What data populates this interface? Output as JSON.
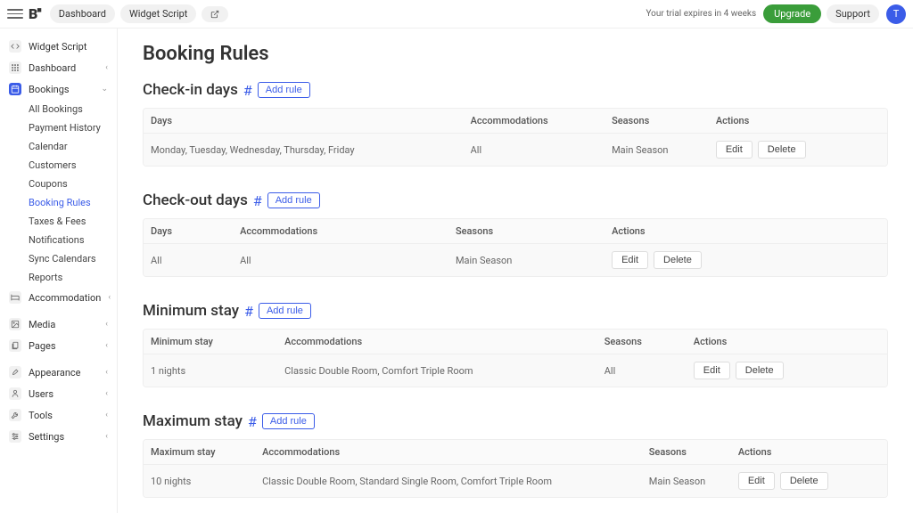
{
  "topbar": {
    "dashboard_label": "Dashboard",
    "widget_script_label": "Widget Script",
    "trial_text": "Your trial expires in 4 weeks",
    "upgrade_label": "Upgrade",
    "support_label": "Support",
    "avatar_initial": "T"
  },
  "sidebar": {
    "items": [
      {
        "label": "Widget Script",
        "icon": "code"
      },
      {
        "label": "Dashboard",
        "icon": "grid",
        "chev": "‹"
      },
      {
        "label": "Bookings",
        "icon": "calendar",
        "active": true,
        "chev": "⌄",
        "sub": [
          {
            "label": "All Bookings"
          },
          {
            "label": "Payment History"
          },
          {
            "label": "Calendar"
          },
          {
            "label": "Customers"
          },
          {
            "label": "Coupons"
          },
          {
            "label": "Booking Rules",
            "selected": true
          },
          {
            "label": "Taxes & Fees"
          },
          {
            "label": "Notifications"
          },
          {
            "label": "Sync Calendars"
          },
          {
            "label": "Reports"
          }
        ]
      },
      {
        "label": "Accommodation",
        "icon": "bed",
        "chev": "‹"
      },
      {
        "label": "Media",
        "icon": "image",
        "chev": "‹"
      },
      {
        "label": "Pages",
        "icon": "pages",
        "chev": "‹"
      },
      {
        "label": "Appearance",
        "icon": "brush",
        "chev": "‹"
      },
      {
        "label": "Users",
        "icon": "user",
        "chev": "‹"
      },
      {
        "label": "Tools",
        "icon": "wrench",
        "chev": "‹"
      },
      {
        "label": "Settings",
        "icon": "sliders",
        "chev": "‹"
      }
    ]
  },
  "page": {
    "title": "Booking Rules",
    "anchor": "#",
    "add_rule_label": "Add rule",
    "edit_label": "Edit",
    "delete_label": "Delete",
    "sections": {
      "checkin": {
        "title": "Check-in days",
        "columns": [
          "Days",
          "Accommodations",
          "Seasons",
          "Actions"
        ],
        "row": {
          "days": "Monday, Tuesday, Wednesday, Thursday, Friday",
          "accom": "All",
          "season": "Main Season"
        }
      },
      "checkout": {
        "title": "Check-out days",
        "columns": [
          "Days",
          "Accommodations",
          "Seasons",
          "Actions"
        ],
        "row": {
          "days": "All",
          "accom": "All",
          "season": "Main Season"
        }
      },
      "minstay": {
        "title": "Minimum stay",
        "columns": [
          "Minimum stay",
          "Accommodations",
          "Seasons",
          "Actions"
        ],
        "row": {
          "val": "1 nights",
          "accom": "Classic Double Room, Comfort Triple Room",
          "season": "All"
        }
      },
      "maxstay": {
        "title": "Maximum stay",
        "columns": [
          "Maximum stay",
          "Accommodations",
          "Seasons",
          "Actions"
        ],
        "row": {
          "val": "10 nights",
          "accom": "Classic Double Room, Standard Single Room, Comfort Triple Room",
          "season": "Main Season"
        }
      }
    }
  }
}
